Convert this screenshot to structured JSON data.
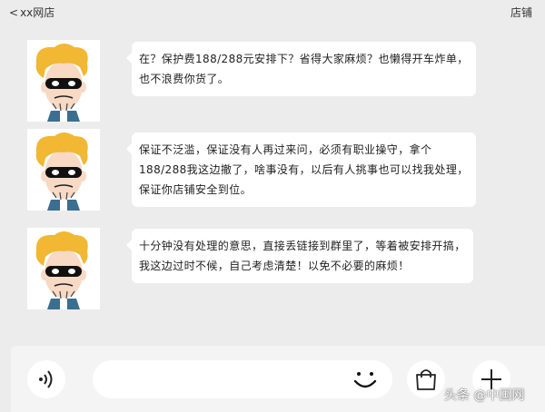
{
  "header": {
    "back_chevron": "<",
    "back_label": "xx网店",
    "shop_label": "店铺"
  },
  "messages": [
    {
      "lines": [
        "在？保护费188/288元安排下？省得大家麻烦？也懒得开车炸单，",
        "也不浪费你货了。"
      ]
    },
    {
      "lines": [
        "保证不泛滥，保证没有人再过来问，必须有职业操守，拿个",
        "188/288我这边撤了，啥事没有，以后有人挑事也可以找我处理，",
        "保证你店铺安全到位。"
      ]
    },
    {
      "lines": [
        "十分钟没有处理的意思，直接丢链接到群里了，等着被安排开搞，",
        "我这边过时不候，自己考虑清楚！以免不必要的麻烦！"
      ]
    }
  ],
  "input": {
    "placeholder": ""
  },
  "watermark": "头条 @中国网",
  "icons": {
    "voice": "voice-icon",
    "emoji": "smiley-icon",
    "bag": "shopping-bag-icon",
    "plus": "plus-icon"
  },
  "colors": {
    "background": "#ececec",
    "bubble": "#ffffff",
    "hair": "#f2b733",
    "mask": "#111111",
    "shirt": "#3a6f8f"
  }
}
